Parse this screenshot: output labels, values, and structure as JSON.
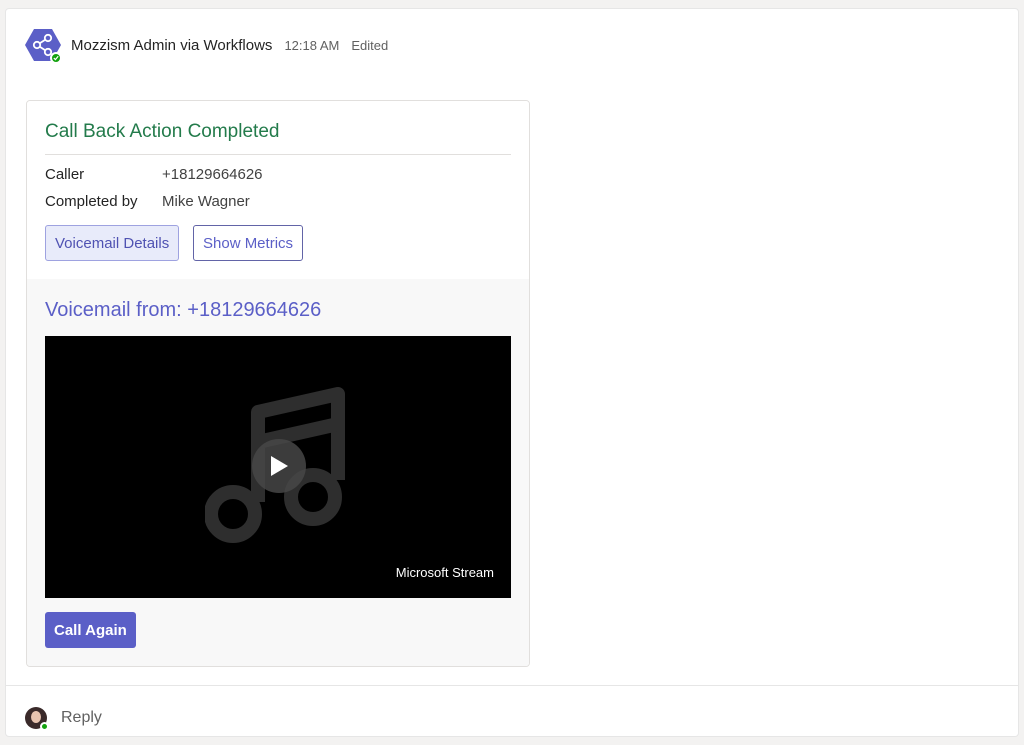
{
  "message": {
    "sender": "Mozzism Admin via Workflows",
    "time": "12:18 AM",
    "status": "Edited",
    "avatar_icon": "workflows-share-icon",
    "avatar_color": "#5b5fc7",
    "presence_color": "#13a10e"
  },
  "card": {
    "title": "Call Back Action Completed",
    "title_color": "#237b4b",
    "facts": [
      {
        "label": "Caller",
        "value": "+18129664626"
      },
      {
        "label": "Completed by",
        "value": "Mike Wagner"
      }
    ],
    "actions": {
      "voicemail_details": "Voicemail Details",
      "show_metrics": "Show Metrics"
    },
    "voicemail": {
      "title": "Voicemail from: +18129664626",
      "player_label": "Microsoft Stream",
      "player_icon": "music-note-icon"
    },
    "call_again": "Call Again",
    "accent_color": "#5b5fc7"
  },
  "reply": {
    "label": "Reply"
  }
}
